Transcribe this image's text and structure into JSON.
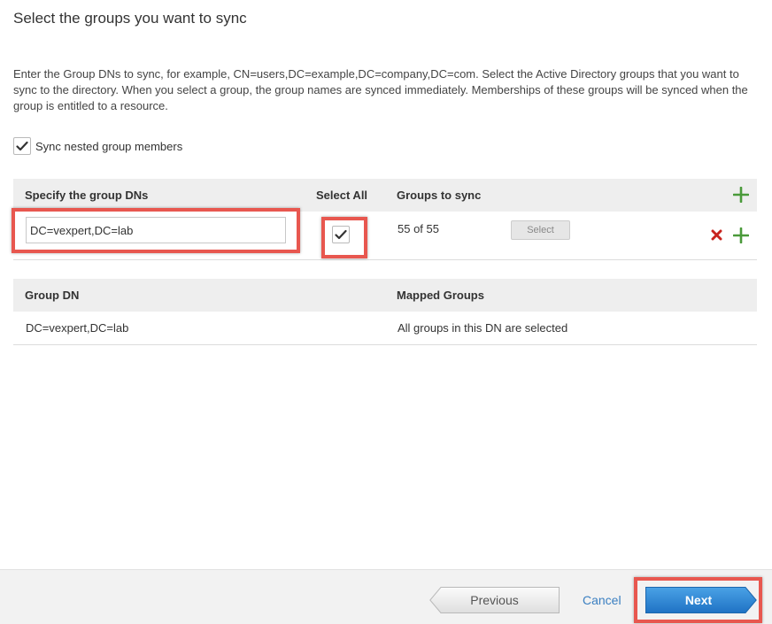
{
  "page": {
    "title": "Select the groups you want to sync",
    "description": "Enter the Group DNs to sync, for example, CN=users,DC=example,DC=company,DC=com. Select the Active Directory groups that you want to sync to the directory. When you select a group, the group names are synced immediately. Memberships of these groups will be synced when the group is entitled to a resource."
  },
  "nested_sync": {
    "label": "Sync nested group members",
    "checked": true
  },
  "group_table": {
    "headers": {
      "dn": "Specify the group DNs",
      "select_all": "Select All",
      "groups": "Groups to sync"
    },
    "rows": [
      {
        "dn_value": "DC=vexpert,DC=lab",
        "select_all_checked": true,
        "groups_count": "55 of 55",
        "select_label": "Select"
      }
    ]
  },
  "mapped_table": {
    "headers": {
      "dn": "Group DN",
      "mapped": "Mapped Groups"
    },
    "rows": [
      {
        "dn": "DC=vexpert,DC=lab",
        "mapped": "All groups in this DN are selected"
      }
    ]
  },
  "footer": {
    "previous_label": "Previous",
    "cancel_label": "Cancel",
    "next_label": "Next"
  },
  "icons": {
    "add": "plus-icon",
    "remove": "x-icon",
    "check": "check-icon"
  },
  "colors": {
    "add_green": "#4a9a3a",
    "remove_red": "#c8221d",
    "highlight": "#e8574f",
    "next_blue": "#2f8ad6",
    "link_blue": "#3a7fc1"
  }
}
